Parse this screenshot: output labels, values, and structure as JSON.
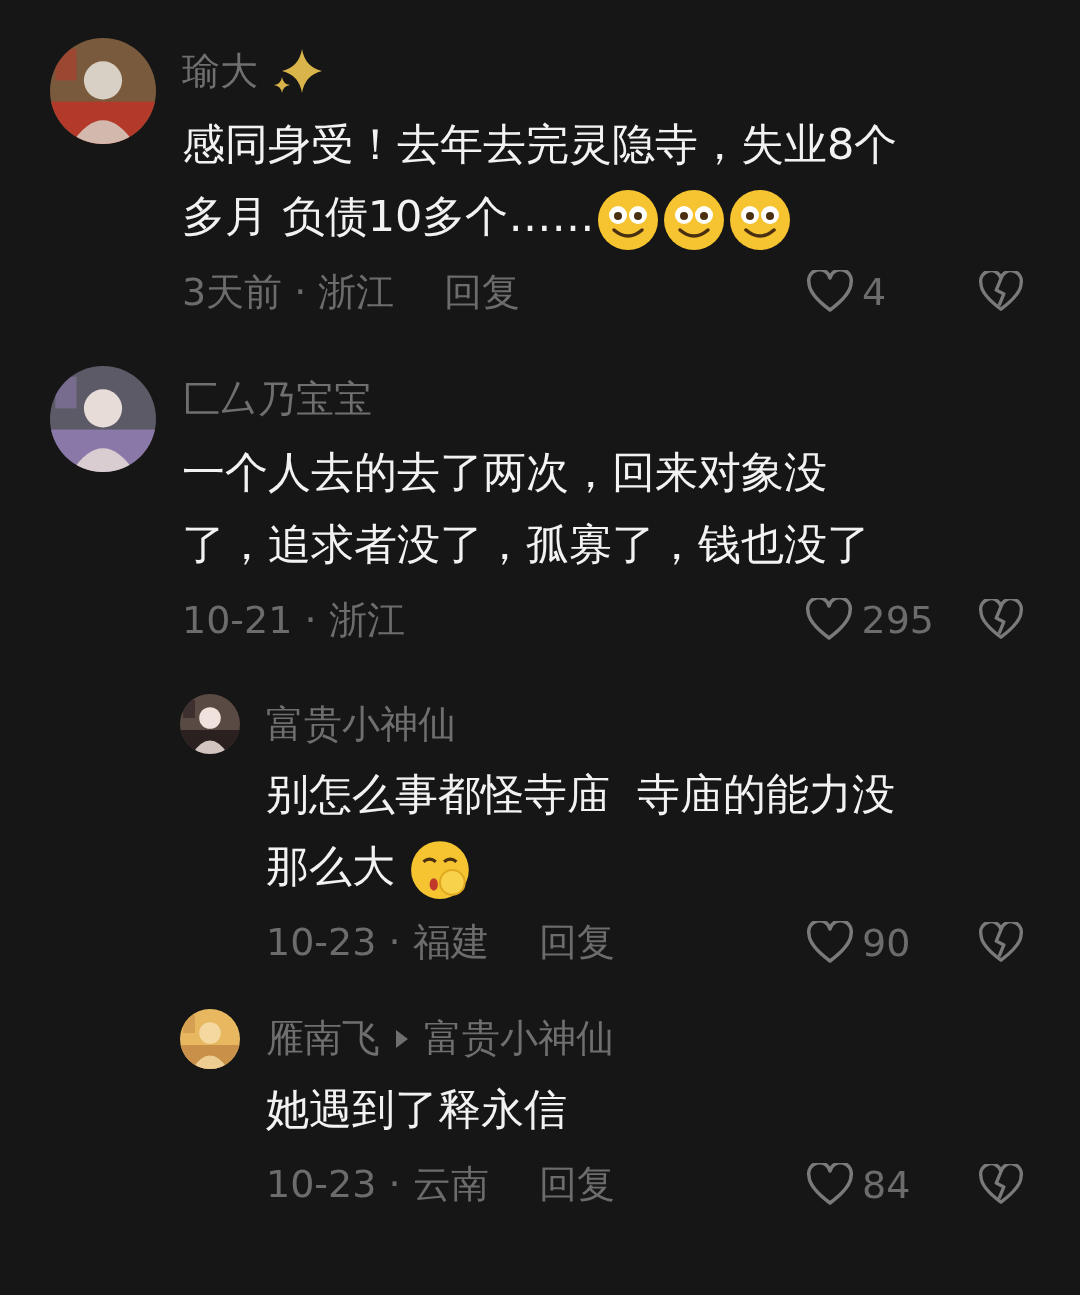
{
  "comments": [
    {
      "author": "瑜大",
      "sparkles": true,
      "body": [
        {
          "kind": "text",
          "text": "感同身受！去年去完灵隐寺，失业8个多月 负债10多个……"
        },
        {
          "kind": "smiley"
        },
        {
          "kind": "smiley"
        },
        {
          "kind": "smiley"
        }
      ],
      "date": "3天前 · 浙江",
      "reply": "回复",
      "likes": "4"
    },
    {
      "author": "匚厶乃宝宝",
      "sparkles": false,
      "body": [
        {
          "kind": "text",
          "text": "一个人去的去了两次，回来对象没了，追求者没了，孤寡了，钱也没了"
        }
      ],
      "date": "10-21 · 浙江",
      "likes": "295",
      "replies": [
        {
          "author": "富贵小神仙",
          "body": [
            {
              "kind": "text",
              "text": "别怎么事都怪寺庙  寺庙的能力没那么大 "
            },
            {
              "kind": "shush"
            }
          ],
          "date": "10-23 · 福建",
          "reply": "回复",
          "likes": "90"
        },
        {
          "author": "雁南飞",
          "reply_to": "富贵小神仙",
          "body": [
            {
              "kind": "text",
              "text": "她遇到了释永信"
            }
          ],
          "date": "10-23 · 云南",
          "reply": "回复",
          "likes": "84"
        }
      ]
    }
  ]
}
